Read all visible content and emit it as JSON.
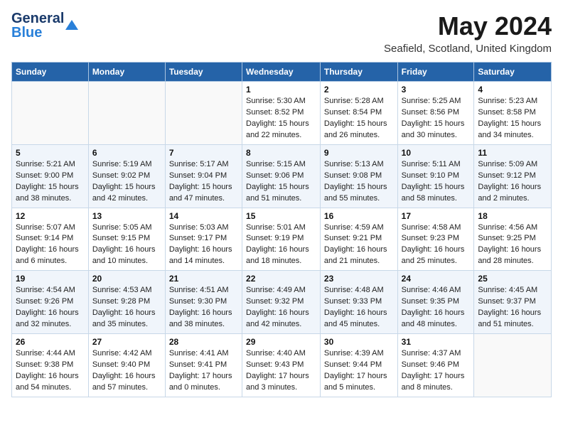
{
  "header": {
    "logo_general": "General",
    "logo_blue": "Blue",
    "month_title": "May 2024",
    "location": "Seafield, Scotland, United Kingdom"
  },
  "days_of_week": [
    "Sunday",
    "Monday",
    "Tuesday",
    "Wednesday",
    "Thursday",
    "Friday",
    "Saturday"
  ],
  "weeks": [
    [
      {
        "day": "",
        "sunrise": "",
        "sunset": "",
        "daylight": ""
      },
      {
        "day": "",
        "sunrise": "",
        "sunset": "",
        "daylight": ""
      },
      {
        "day": "",
        "sunrise": "",
        "sunset": "",
        "daylight": ""
      },
      {
        "day": "1",
        "sunrise": "Sunrise: 5:30 AM",
        "sunset": "Sunset: 8:52 PM",
        "daylight": "Daylight: 15 hours and 22 minutes."
      },
      {
        "day": "2",
        "sunrise": "Sunrise: 5:28 AM",
        "sunset": "Sunset: 8:54 PM",
        "daylight": "Daylight: 15 hours and 26 minutes."
      },
      {
        "day": "3",
        "sunrise": "Sunrise: 5:25 AM",
        "sunset": "Sunset: 8:56 PM",
        "daylight": "Daylight: 15 hours and 30 minutes."
      },
      {
        "day": "4",
        "sunrise": "Sunrise: 5:23 AM",
        "sunset": "Sunset: 8:58 PM",
        "daylight": "Daylight: 15 hours and 34 minutes."
      }
    ],
    [
      {
        "day": "5",
        "sunrise": "Sunrise: 5:21 AM",
        "sunset": "Sunset: 9:00 PM",
        "daylight": "Daylight: 15 hours and 38 minutes."
      },
      {
        "day": "6",
        "sunrise": "Sunrise: 5:19 AM",
        "sunset": "Sunset: 9:02 PM",
        "daylight": "Daylight: 15 hours and 42 minutes."
      },
      {
        "day": "7",
        "sunrise": "Sunrise: 5:17 AM",
        "sunset": "Sunset: 9:04 PM",
        "daylight": "Daylight: 15 hours and 47 minutes."
      },
      {
        "day": "8",
        "sunrise": "Sunrise: 5:15 AM",
        "sunset": "Sunset: 9:06 PM",
        "daylight": "Daylight: 15 hours and 51 minutes."
      },
      {
        "day": "9",
        "sunrise": "Sunrise: 5:13 AM",
        "sunset": "Sunset: 9:08 PM",
        "daylight": "Daylight: 15 hours and 55 minutes."
      },
      {
        "day": "10",
        "sunrise": "Sunrise: 5:11 AM",
        "sunset": "Sunset: 9:10 PM",
        "daylight": "Daylight: 15 hours and 58 minutes."
      },
      {
        "day": "11",
        "sunrise": "Sunrise: 5:09 AM",
        "sunset": "Sunset: 9:12 PM",
        "daylight": "Daylight: 16 hours and 2 minutes."
      }
    ],
    [
      {
        "day": "12",
        "sunrise": "Sunrise: 5:07 AM",
        "sunset": "Sunset: 9:14 PM",
        "daylight": "Daylight: 16 hours and 6 minutes."
      },
      {
        "day": "13",
        "sunrise": "Sunrise: 5:05 AM",
        "sunset": "Sunset: 9:15 PM",
        "daylight": "Daylight: 16 hours and 10 minutes."
      },
      {
        "day": "14",
        "sunrise": "Sunrise: 5:03 AM",
        "sunset": "Sunset: 9:17 PM",
        "daylight": "Daylight: 16 hours and 14 minutes."
      },
      {
        "day": "15",
        "sunrise": "Sunrise: 5:01 AM",
        "sunset": "Sunset: 9:19 PM",
        "daylight": "Daylight: 16 hours and 18 minutes."
      },
      {
        "day": "16",
        "sunrise": "Sunrise: 4:59 AM",
        "sunset": "Sunset: 9:21 PM",
        "daylight": "Daylight: 16 hours and 21 minutes."
      },
      {
        "day": "17",
        "sunrise": "Sunrise: 4:58 AM",
        "sunset": "Sunset: 9:23 PM",
        "daylight": "Daylight: 16 hours and 25 minutes."
      },
      {
        "day": "18",
        "sunrise": "Sunrise: 4:56 AM",
        "sunset": "Sunset: 9:25 PM",
        "daylight": "Daylight: 16 hours and 28 minutes."
      }
    ],
    [
      {
        "day": "19",
        "sunrise": "Sunrise: 4:54 AM",
        "sunset": "Sunset: 9:26 PM",
        "daylight": "Daylight: 16 hours and 32 minutes."
      },
      {
        "day": "20",
        "sunrise": "Sunrise: 4:53 AM",
        "sunset": "Sunset: 9:28 PM",
        "daylight": "Daylight: 16 hours and 35 minutes."
      },
      {
        "day": "21",
        "sunrise": "Sunrise: 4:51 AM",
        "sunset": "Sunset: 9:30 PM",
        "daylight": "Daylight: 16 hours and 38 minutes."
      },
      {
        "day": "22",
        "sunrise": "Sunrise: 4:49 AM",
        "sunset": "Sunset: 9:32 PM",
        "daylight": "Daylight: 16 hours and 42 minutes."
      },
      {
        "day": "23",
        "sunrise": "Sunrise: 4:48 AM",
        "sunset": "Sunset: 9:33 PM",
        "daylight": "Daylight: 16 hours and 45 minutes."
      },
      {
        "day": "24",
        "sunrise": "Sunrise: 4:46 AM",
        "sunset": "Sunset: 9:35 PM",
        "daylight": "Daylight: 16 hours and 48 minutes."
      },
      {
        "day": "25",
        "sunrise": "Sunrise: 4:45 AM",
        "sunset": "Sunset: 9:37 PM",
        "daylight": "Daylight: 16 hours and 51 minutes."
      }
    ],
    [
      {
        "day": "26",
        "sunrise": "Sunrise: 4:44 AM",
        "sunset": "Sunset: 9:38 PM",
        "daylight": "Daylight: 16 hours and 54 minutes."
      },
      {
        "day": "27",
        "sunrise": "Sunrise: 4:42 AM",
        "sunset": "Sunset: 9:40 PM",
        "daylight": "Daylight: 16 hours and 57 minutes."
      },
      {
        "day": "28",
        "sunrise": "Sunrise: 4:41 AM",
        "sunset": "Sunset: 9:41 PM",
        "daylight": "Daylight: 17 hours and 0 minutes."
      },
      {
        "day": "29",
        "sunrise": "Sunrise: 4:40 AM",
        "sunset": "Sunset: 9:43 PM",
        "daylight": "Daylight: 17 hours and 3 minutes."
      },
      {
        "day": "30",
        "sunrise": "Sunrise: 4:39 AM",
        "sunset": "Sunset: 9:44 PM",
        "daylight": "Daylight: 17 hours and 5 minutes."
      },
      {
        "day": "31",
        "sunrise": "Sunrise: 4:37 AM",
        "sunset": "Sunset: 9:46 PM",
        "daylight": "Daylight: 17 hours and 8 minutes."
      },
      {
        "day": "",
        "sunrise": "",
        "sunset": "",
        "daylight": ""
      }
    ]
  ]
}
